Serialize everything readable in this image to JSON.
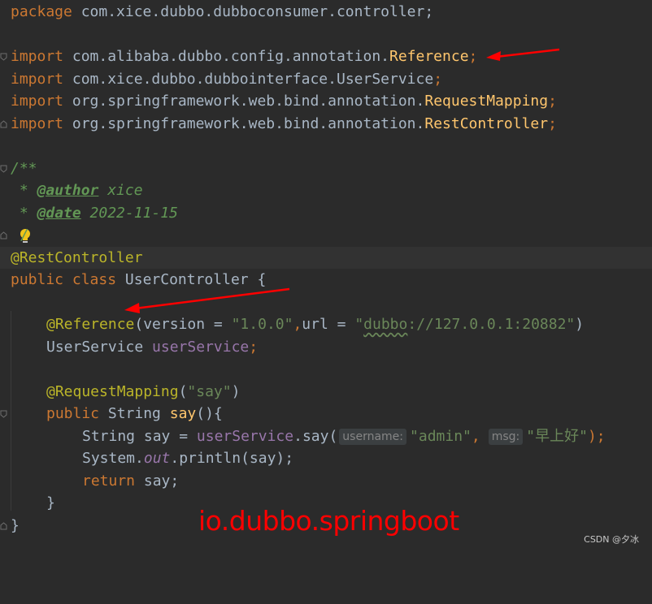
{
  "code": {
    "line1": {
      "kw": "package",
      "rest": " com.xice.dubbo.dubboconsumer.controller;"
    },
    "line3": {
      "kw": "import",
      "path": " com.alibaba.dubbo.config.annotation.",
      "cls": "Reference",
      "end": ";"
    },
    "line4": {
      "kw": "import",
      "path": " com.xice.dubbo.dubbointerface.UserService",
      "end": ";"
    },
    "line5": {
      "kw": "import",
      "path": " org.springframework.web.bind.annotation.",
      "cls": "RequestMapping",
      "end": ";"
    },
    "line6": {
      "kw": "import",
      "path": " org.springframework.web.bind.annotation.",
      "cls": "RestController",
      "end": ";"
    },
    "line8": {
      "text": "/**"
    },
    "line9": {
      "star": " * ",
      "tag": "@author",
      "val": " xice"
    },
    "line10": {
      "star": " * ",
      "tag": "@date",
      "val": " 2022-11-15"
    },
    "line11": {
      "text": "/"
    },
    "line12": {
      "ann": "@RestController"
    },
    "line13": {
      "kw1": "public",
      "kw2": " class",
      "name": " UserController {"
    },
    "line15": {
      "ann": "@Reference",
      "p1": "(version = ",
      "s1": "\"1.0.0\"",
      "comma": ",",
      "p2": "url = ",
      "s2a": "\"",
      "s2b": "dubbo",
      "s2c": "://127.0.0.1:20882\"",
      "p3": ")"
    },
    "line16": {
      "type": "UserService ",
      "field": "userService",
      "end": ";"
    },
    "line18": {
      "ann": "@RequestMapping",
      "p1": "(",
      "s": "\"say\"",
      "p2": ")"
    },
    "line19": {
      "kw": "public",
      "rest": " String ",
      "method": "say",
      "end": "(){"
    },
    "line20": {
      "a": "String say = ",
      "field": "userService",
      "b": ".say(",
      "hint1": "username:",
      "s1": "\"admin\"",
      "comma": ",",
      "hint2": "msg:",
      "s2": "\"早上好\"",
      "end": ");"
    },
    "line21": {
      "a": "System.",
      "out": "out",
      "b": ".println(say);"
    },
    "line22": {
      "kw": "return",
      "rest": " say;"
    },
    "line23": {
      "text": "}"
    },
    "line24": {
      "text": "}"
    }
  },
  "overlay_title": "io.dubbo.springboot",
  "watermark": "CSDN @夕冰",
  "colors": {
    "background": "#2b2b2b",
    "keyword": "#cc7832",
    "annotation": "#bbb529",
    "string": "#6a8759",
    "field": "#9876aa",
    "arrow": "#ff0000"
  }
}
